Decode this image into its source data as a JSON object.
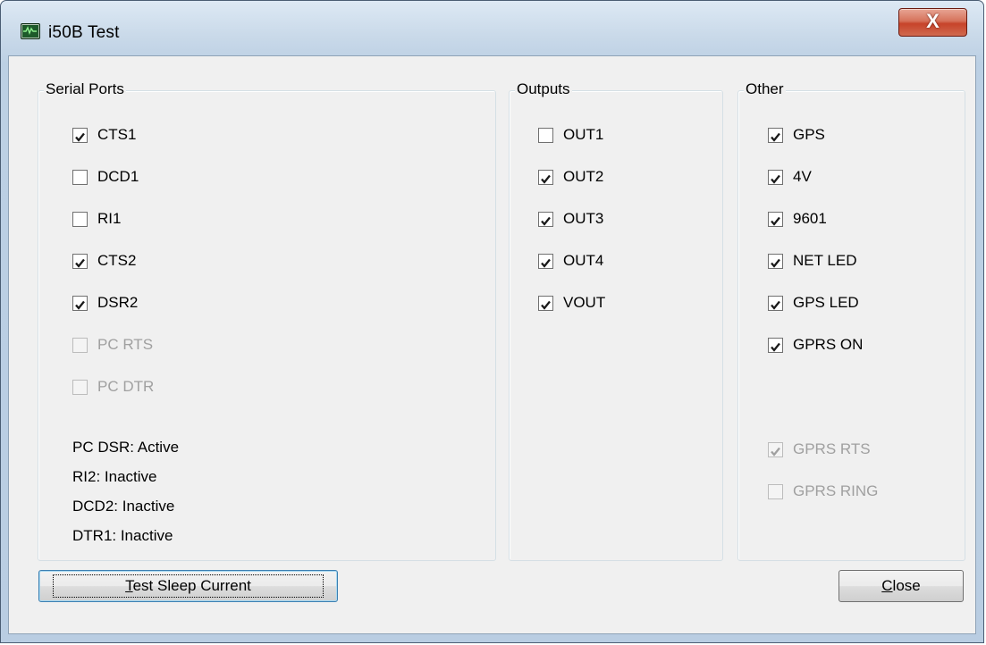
{
  "window": {
    "title": "i50B Test",
    "close_glyph": "X"
  },
  "serial_ports": {
    "label": "Serial Ports",
    "checkboxes": [
      {
        "label": "CTS1",
        "checked": true,
        "enabled": true
      },
      {
        "label": "DCD1",
        "checked": false,
        "enabled": true
      },
      {
        "label": "RI1",
        "checked": false,
        "enabled": true
      },
      {
        "label": "CTS2",
        "checked": true,
        "enabled": true
      },
      {
        "label": "DSR2",
        "checked": true,
        "enabled": true
      },
      {
        "label": "PC RTS",
        "checked": false,
        "enabled": false
      },
      {
        "label": "PC DTR",
        "checked": false,
        "enabled": false
      }
    ],
    "status": [
      "PC DSR: Active",
      "RI2: Inactive",
      "DCD2: Inactive",
      "DTR1: Inactive"
    ]
  },
  "outputs": {
    "label": "Outputs",
    "checkboxes": [
      {
        "label": "OUT1",
        "checked": false,
        "enabled": true
      },
      {
        "label": "OUT2",
        "checked": true,
        "enabled": true
      },
      {
        "label": "OUT3",
        "checked": true,
        "enabled": true
      },
      {
        "label": "OUT4",
        "checked": true,
        "enabled": true
      },
      {
        "label": "VOUT",
        "checked": true,
        "enabled": true
      }
    ]
  },
  "other": {
    "label": "Other",
    "checkboxes": [
      {
        "label": "GPS",
        "checked": true,
        "enabled": true
      },
      {
        "label": "4V",
        "checked": true,
        "enabled": true
      },
      {
        "label": "9601",
        "checked": true,
        "enabled": true
      },
      {
        "label": "NET LED",
        "checked": true,
        "enabled": true
      },
      {
        "label": "GPS LED",
        "checked": true,
        "enabled": true
      },
      {
        "label": "GPRS ON",
        "checked": true,
        "enabled": true
      },
      {
        "label": "GPRS RTS",
        "checked": true,
        "enabled": false
      },
      {
        "label": "GPRS RING",
        "checked": false,
        "enabled": false
      }
    ]
  },
  "buttons": {
    "test_sleep": {
      "accel": "T",
      "rest": "est Sleep Current"
    },
    "close": {
      "accel": "C",
      "rest": "lose"
    }
  },
  "colors": {
    "title_bar": "#c9d9e9",
    "close_button": "#c7432a",
    "dialog_face": "#f0f0f0",
    "disabled_text": "#a0a0a0"
  }
}
